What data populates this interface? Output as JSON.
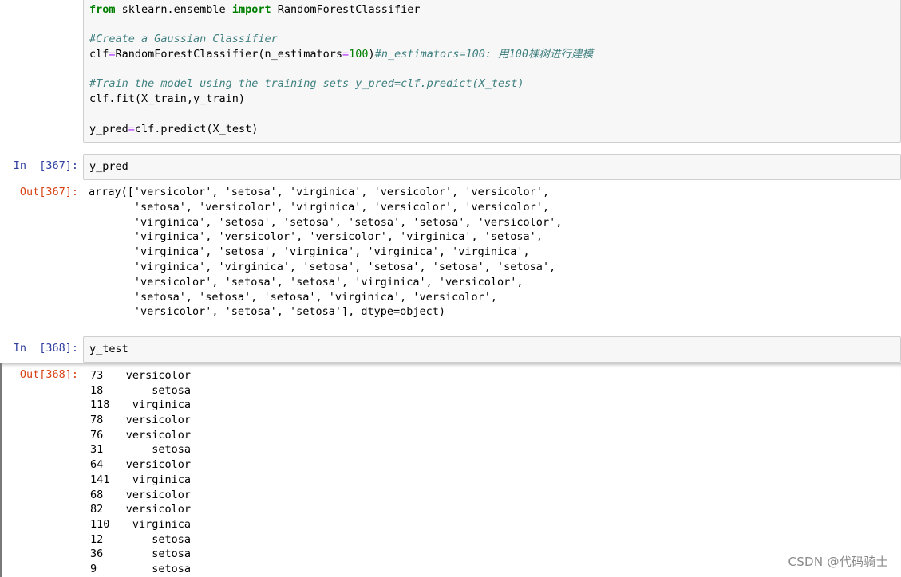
{
  "cell_top": {
    "lines": [
      [
        {
          "t": "from",
          "c": "kw"
        },
        {
          "t": " sklearn.ensemble "
        },
        {
          "t": "import",
          "c": "kw"
        },
        {
          "t": " RandomForestClassifier"
        }
      ],
      [],
      [
        {
          "t": "#Create a Gaussian Classifier",
          "c": "cm"
        }
      ],
      [
        {
          "t": "clf"
        },
        {
          "t": "=",
          "c": "op"
        },
        {
          "t": "RandomForestClassifier(n_estimators"
        },
        {
          "t": "=",
          "c": "op"
        },
        {
          "t": "100",
          "c": "num"
        },
        {
          "t": ")"
        },
        {
          "t": "#n_estimators=100: 用100棵树进行建模",
          "c": "cm"
        }
      ],
      [],
      [
        {
          "t": "#Train the model using the training sets y_pred=clf.predict(X_test)",
          "c": "cm"
        }
      ],
      [
        {
          "t": "clf.fit(X_train,y_train)"
        }
      ],
      [],
      [
        {
          "t": "y_pred"
        },
        {
          "t": "=",
          "c": "op"
        },
        {
          "t": "clf.predict(X_test)"
        }
      ]
    ]
  },
  "cell_367": {
    "in_prompt": "In  [367]:",
    "code": "y_pred",
    "out_prompt": "Out[367]:",
    "output_lines": [
      "array(['versicolor', 'setosa', 'virginica', 'versicolor', 'versicolor',",
      "       'setosa', 'versicolor', 'virginica', 'versicolor', 'versicolor',",
      "       'virginica', 'setosa', 'setosa', 'setosa', 'setosa', 'versicolor',",
      "       'virginica', 'versicolor', 'versicolor', 'virginica', 'setosa',",
      "       'virginica', 'setosa', 'virginica', 'virginica', 'virginica',",
      "       'virginica', 'virginica', 'setosa', 'setosa', 'setosa', 'setosa',",
      "       'versicolor', 'setosa', 'setosa', 'virginica', 'versicolor',",
      "       'setosa', 'setosa', 'setosa', 'virginica', 'versicolor',",
      "       'versicolor', 'setosa', 'setosa'], dtype=object)"
    ]
  },
  "cell_368": {
    "in_prompt": "In  [368]:",
    "code": "y_test",
    "out_prompt": "Out[368]:",
    "series": [
      {
        "index": "73",
        "value": "versicolor"
      },
      {
        "index": "18",
        "value": "setosa"
      },
      {
        "index": "118",
        "value": "virginica"
      },
      {
        "index": "78",
        "value": "versicolor"
      },
      {
        "index": "76",
        "value": "versicolor"
      },
      {
        "index": "31",
        "value": "setosa"
      },
      {
        "index": "64",
        "value": "versicolor"
      },
      {
        "index": "141",
        "value": "virginica"
      },
      {
        "index": "68",
        "value": "versicolor"
      },
      {
        "index": "82",
        "value": "versicolor"
      },
      {
        "index": "110",
        "value": "virginica"
      },
      {
        "index": "12",
        "value": "setosa"
      },
      {
        "index": "36",
        "value": "setosa"
      },
      {
        "index": "9",
        "value": "setosa"
      }
    ]
  },
  "watermark": "CSDN @代码骑士",
  "colors": {
    "in_prompt": "#303f9f",
    "out_prompt": "#d84315",
    "keyword": "#008000",
    "comment": "#408080",
    "operator": "#aa22ff",
    "cell_bg": "#f7f7f7"
  }
}
